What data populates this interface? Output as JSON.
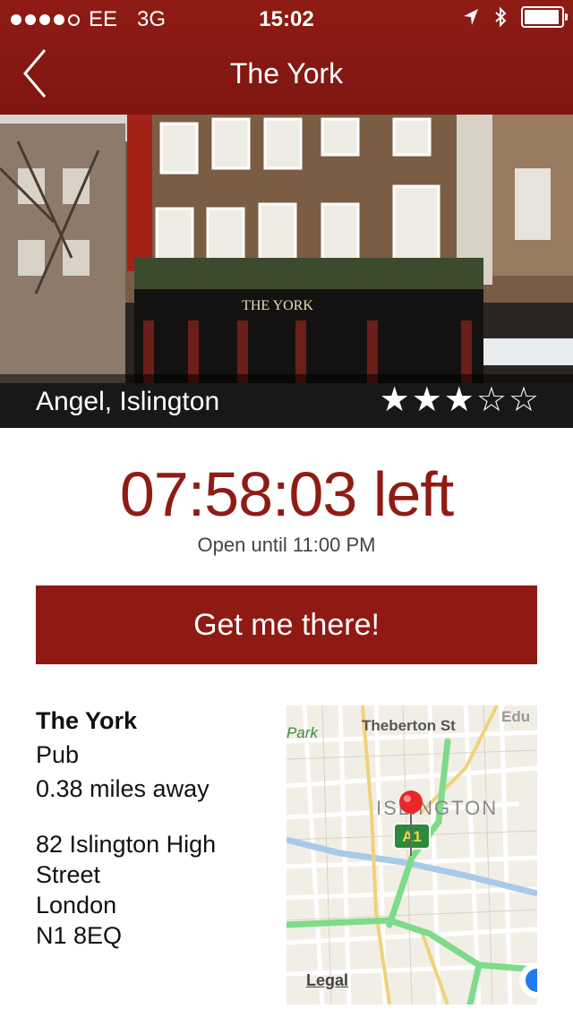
{
  "status_bar": {
    "carrier": "EE",
    "network": "3G",
    "time": "15:02"
  },
  "nav": {
    "title": "The York"
  },
  "hero": {
    "location": "Angel, Islington",
    "sign_text": "THE YORK",
    "rating": 3,
    "rating_max": 5
  },
  "countdown": {
    "time_left": "07:58:03 left",
    "open_until": "Open until 11:00 PM"
  },
  "cta": {
    "label": "Get me there!"
  },
  "details": {
    "name": "The York",
    "type": "Pub",
    "distance": "0.38 miles away",
    "address_lines": [
      "82 Islington High",
      "Street",
      "London",
      "N1 8EQ"
    ]
  },
  "map": {
    "labels": {
      "park": "Park",
      "street": "Theberton St",
      "edu": "Edu",
      "area": "ISLINGTON",
      "road_badge": "A1",
      "legal": "Legal"
    },
    "colors": {
      "pin": "#e8272a",
      "road_badge": "#2a8b3c",
      "major_road": "#7edb8a",
      "water": "#a9c9e8"
    }
  },
  "colors": {
    "brand_red": "#8e1a13",
    "countdown_text": "#8e1c15"
  }
}
